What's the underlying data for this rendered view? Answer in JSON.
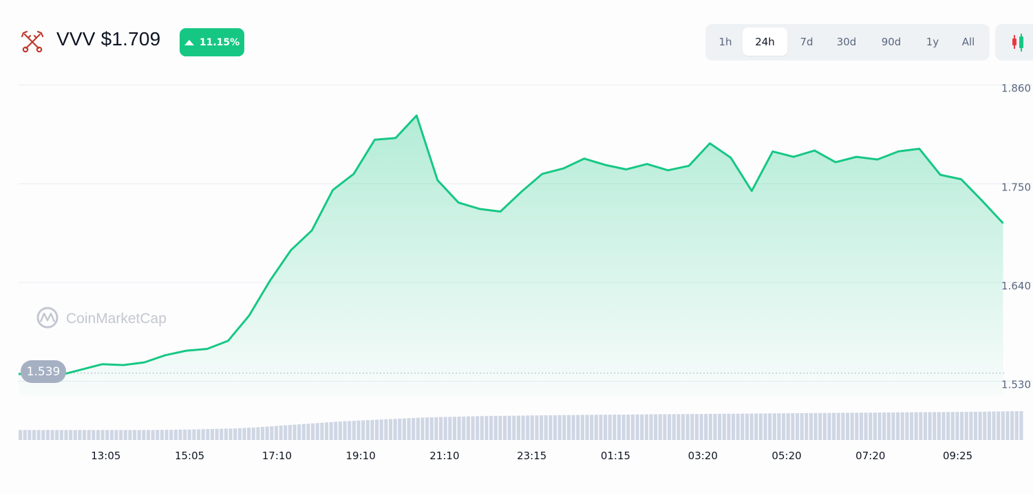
{
  "header": {
    "title": "VVV $1.709",
    "change_pct": "11.15%",
    "logo_icon": "crossed-keys-icon",
    "change_icon": "triangle-up-icon"
  },
  "range_tabs": [
    {
      "label": "1h",
      "active": false
    },
    {
      "label": "24h",
      "active": true
    },
    {
      "label": "7d",
      "active": false
    },
    {
      "label": "30d",
      "active": false
    },
    {
      "label": "90d",
      "active": false
    },
    {
      "label": "1y",
      "active": false
    },
    {
      "label": "All",
      "active": false
    }
  ],
  "chart_toggle_icon": "candlestick-icon",
  "watermark": {
    "text": "CoinMarketCap",
    "icon": "coinmarketcap-logo-icon"
  },
  "colors": {
    "up": "#16c784",
    "down": "#ea3943",
    "text": "#0d1421",
    "muted": "#58667e",
    "volume": "#cfd6e4"
  },
  "chart_data": {
    "type": "area",
    "title": "",
    "xlabel": "",
    "ylabel": "",
    "ylim": [
      1.5128,
      1.8628
    ],
    "yticks": [
      1.86,
      1.75,
      1.64,
      1.53
    ],
    "ytick_labels": [
      "1.860",
      "1.750",
      "1.640",
      "1.530"
    ],
    "xtick_labels": [
      "13:05",
      "15:05",
      "17:10",
      "19:10",
      "21:10",
      "23:15",
      "01:15",
      "03:20",
      "05:20",
      "07:20",
      "09:25"
    ],
    "open_price": 1.539,
    "open_price_label": "1.539",
    "grid": true,
    "series": [
      {
        "x": [
          "11:00",
          "11:30",
          "12:00",
          "12:30",
          "13:00",
          "13:30",
          "14:00",
          "14:30",
          "15:00",
          "15:30",
          "16:00",
          "16:30",
          "17:00",
          "17:30",
          "18:00",
          "18:30",
          "19:00",
          "19:30",
          "20:00",
          "20:30",
          "21:00",
          "21:30",
          "22:00",
          "22:30",
          "23:00",
          "23:30",
          "00:00",
          "00:30",
          "01:00",
          "01:30",
          "02:00",
          "02:30",
          "03:00",
          "03:30",
          "04:00",
          "04:30",
          "05:00",
          "05:30",
          "06:00",
          "06:30",
          "07:00",
          "07:30",
          "08:00",
          "08:30",
          "09:00",
          "09:30",
          "10:00",
          "10:30"
        ],
        "values": [
          1.538,
          1.539,
          1.537,
          1.543,
          1.549,
          1.548,
          1.551,
          1.559,
          1.564,
          1.566,
          1.575,
          1.603,
          1.642,
          1.676,
          1.698,
          1.743,
          1.761,
          1.799,
          1.801,
          1.826,
          1.754,
          1.729,
          1.722,
          1.719,
          1.741,
          1.761,
          1.767,
          1.778,
          1.771,
          1.766,
          1.772,
          1.765,
          1.77,
          1.795,
          1.779,
          1.742,
          1.786,
          1.78,
          1.787,
          1.774,
          1.78,
          1.777,
          1.786,
          1.789,
          1.76,
          1.755,
          1.731,
          1.706
        ]
      }
    ],
    "volume": [
      1,
      1,
      1,
      1,
      1,
      1,
      1,
      1.02,
      1.05,
      1.1,
      1.15,
      1.25,
      1.4,
      1.55,
      1.7,
      1.85,
      1.95,
      2.05,
      2.15,
      2.25,
      2.3,
      2.35,
      2.4,
      2.42,
      2.45,
      2.47,
      2.5,
      2.52,
      2.53,
      2.55,
      2.57,
      2.58,
      2.6,
      2.62,
      2.63,
      2.65,
      2.67,
      2.68,
      2.7,
      2.72,
      2.73,
      2.75,
      2.77,
      2.78,
      2.8,
      2.82,
      2.85,
      2.88
    ]
  }
}
